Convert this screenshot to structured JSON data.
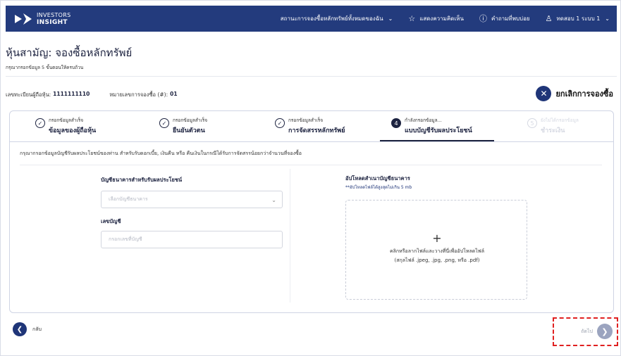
{
  "topbar": {
    "logo_line1": "INVESTORS",
    "logo_line2": "INSIGHT",
    "nav": [
      {
        "label": "สถานะการจองซื้อหลักทรัพย์ทั้งหมดของฉัน",
        "icon": "chevron-down-icon"
      },
      {
        "label": "แสดงความคิดเห็น",
        "icon": "star-icon"
      },
      {
        "label": "คำถามที่พบบ่อย",
        "icon": "help-circle-icon"
      },
      {
        "label": "ทดสอบ 1 ระบบ 1",
        "icon": "user-icon"
      }
    ]
  },
  "header": {
    "title": "หุ้นสามัญ: จองซื้อหลักทรัพย์",
    "subtitle": "กรุณากรอกข้อมูล 5 ขั้นตอนให้ครบถ้วน",
    "reg_label": "เลขทะเบียนผู้ถือหุ้น:",
    "reg_value": "1111111110",
    "booking_label": "หมายเลขการจองซื้อ (#):",
    "booking_value": "01",
    "cancel_label": "ยกเลิกการจองซื้อ"
  },
  "steps": [
    {
      "status": "กรอกข้อมูลสำเร็จ",
      "title": "ข้อมูลของผู้ถือหุ้น",
      "state": "done"
    },
    {
      "status": "กรอกข้อมูลสำเร็จ",
      "title": "ยืนยันตัวตน",
      "state": "done"
    },
    {
      "status": "กรอกข้อมูลสำเร็จ",
      "title": "การจัดสรรหลักทรัพย์",
      "state": "done"
    },
    {
      "number": "4",
      "status": "กำลังกรอกข้อมูล...",
      "title": "แบบบัญชีรับผลประโยชน์",
      "state": "active"
    },
    {
      "number": "5",
      "status": "ยังไม่ได้กรอกข้อมูล",
      "title": "ชำระเงิน",
      "state": "pending"
    }
  ],
  "form": {
    "instruction": "กรุณากรอกข้อมูลบัญชีรับผลประโยชน์ของท่าน สำหรับรับดอกเบี้ย, เงินคืน หรือ คืนเงินในกรณีได้รับการจัดสรรน้อยกว่าจำนวนที่จองซื้อ",
    "bank_label": "บัญชีธนาคารสำหรับรับผลประโยชน์",
    "bank_placeholder": "เลือกบัญชีธนาคาร",
    "account_label": "เลขบัญชี",
    "account_placeholder": "กรอกเลขที่บัญชี",
    "upload_label": "อัปโหลดสำเนาบัญชีธนาคาร",
    "upload_note": "**อัปโหลดไฟล์ได้สูงสุดไม่เกิน 5 mb",
    "dropzone_plus": "+",
    "dropzone_line1": "คลิกหรือลากไฟล์และวางที่นี่เพื่ออัปโหลดไฟล์",
    "dropzone_line2": "(สกุลไฟล์ .jpeg, .jpg, .png, หรือ .pdf)"
  },
  "footer": {
    "back_label": "กลับ",
    "next_label": "ถัดไป"
  },
  "colors": {
    "topbar": "#233b7d",
    "primary": "#1f3578",
    "highlight": "#e02020"
  }
}
